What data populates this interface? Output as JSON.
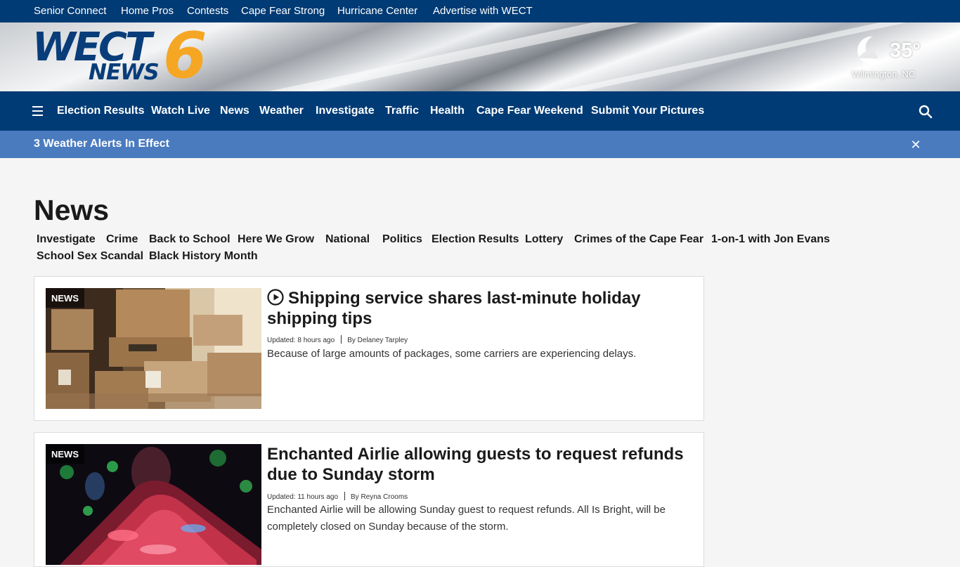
{
  "top_links": [
    "Senior Connect",
    "Home Pros",
    "Contests",
    "Cape Fear Strong",
    "Hurricane Center",
    "Advertise with WECT"
  ],
  "logo": {
    "text_wect": "WECT",
    "text_news": "NEWS",
    "text_six": "6"
  },
  "weather": {
    "icon": "moon-icon",
    "temp": "35°",
    "location": "Wilmington, NC"
  },
  "nav": {
    "menu_icon": "hamburger-menu-icon",
    "items": [
      "Election Results",
      "Watch Live",
      "News",
      "Weather",
      "Investigate",
      "Traffic",
      "Health",
      "Cape Fear Weekend",
      "Submit Your Pictures"
    ],
    "search_icon": "search-icon"
  },
  "alert": {
    "text": "3 Weather Alerts In Effect",
    "close_icon": "close-icon"
  },
  "page": {
    "title": "News",
    "subnav": [
      "Investigate",
      "Crime",
      "Back to School",
      "Here We Grow",
      "National",
      "Politics",
      "Election Results",
      "Lottery",
      "Crimes of the Cape Fear",
      "1-on-1 with Jon Evans",
      "School Sex Scandal",
      "Black History Month"
    ]
  },
  "articles": [
    {
      "tag": "NEWS",
      "has_video": true,
      "headline": "Shipping service shares last-minute holiday shipping tips",
      "updated": "Updated: 8 hours ago",
      "byline": "By Delaney Tarpley",
      "summary": "Because of large amounts of packages, some carriers are experiencing delays."
    },
    {
      "tag": "NEWS",
      "has_video": false,
      "headline": "Enchanted Airlie allowing guests to request refunds due to Sunday storm",
      "updated": "Updated: 11 hours ago",
      "byline": "By Reyna Crooms",
      "summary": "Enchanted Airlie will be allowing Sunday guest to request refunds. All Is Bright, will be completely closed on Sunday because of the storm."
    }
  ],
  "colors": {
    "navy": "#003b75",
    "alert_blue": "#4a7bbf",
    "logo_orange": "#f5a623",
    "logo_navy": "#083d7a"
  }
}
